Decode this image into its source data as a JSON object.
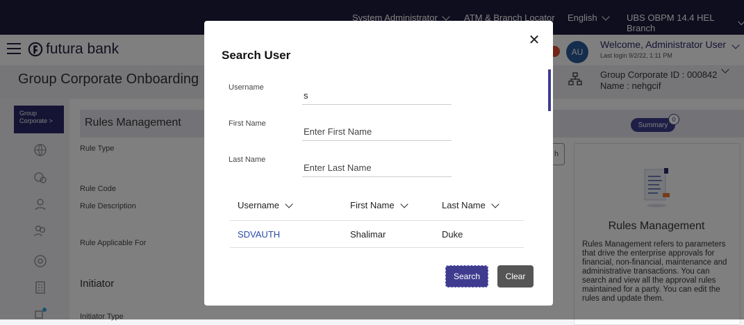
{
  "topbar": {
    "user_menu": "System Administrator",
    "locator": "ATM & Branch Locator",
    "language": "English",
    "environment": "UBS OBPM 14.4 HEL Branch"
  },
  "header": {
    "brand": "futura bank",
    "avatar_initials": "AU",
    "welcome": "Welcome, Administrator User",
    "last_login": "Last login 9/2/22, 1:11 PM"
  },
  "page": {
    "title": "Group Corporate Onboarding",
    "group_corporate_id": "Group Corporate ID : 000842",
    "group_corporate_name": "Name : nehgcif"
  },
  "sidebar": {
    "active_tab": "Group Corporate >",
    "icons": [
      "globe-icon",
      "world-icon",
      "user-badge-icon",
      "users-icon",
      "support-icon",
      "building-icon",
      "network-icon"
    ]
  },
  "main": {
    "section_title": "Rules Management",
    "fields": [
      "Rule Type",
      "Rule Code",
      "Rule Description",
      "Rule Applicable For"
    ],
    "initiator_heading": "Initiator",
    "initiator_type_label": "Initiator Type",
    "partial_button": "h"
  },
  "summary": {
    "label": "Summary",
    "count": "0"
  },
  "info_card": {
    "title": "Rules Management",
    "text": "Rules Management refers to parameters that drive the enterprise approvals for financial, non-financial, maintenance and administrative transactions. You can search and view all the approval rules maintained for a party. You can edit the rules and update them."
  },
  "modal": {
    "title": "Search User",
    "username_label": "Username",
    "username_value": "s",
    "first_name_label": "First Name",
    "first_name_placeholder": "Enter First Name",
    "last_name_label": "Last Name",
    "last_name_placeholder": "Enter Last Name",
    "table": {
      "headers": [
        "Username",
        "First Name",
        "Last Name"
      ],
      "rows": [
        [
          "SDVAUTH",
          "Shalimar",
          "Duke"
        ]
      ]
    },
    "search_button": "Search",
    "clear_button": "Clear"
  },
  "colors": {
    "brand_dark": "#1f1d3f",
    "primary": "#3f3c8f",
    "link": "#2a4aa8"
  }
}
